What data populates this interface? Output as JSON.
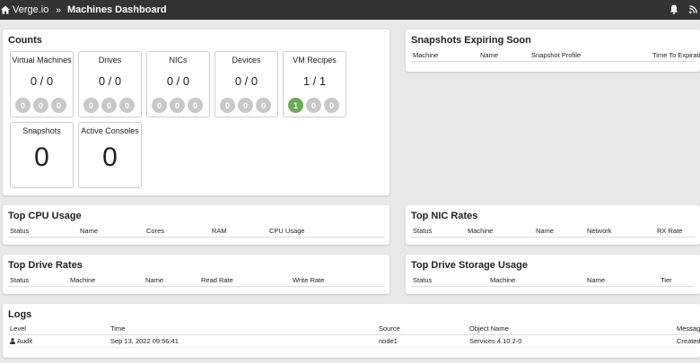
{
  "header": {
    "brand": "Verge.io",
    "separator": "»",
    "title": "Machines Dashboard"
  },
  "counts": {
    "title": "Counts",
    "tiles": [
      {
        "label": "Virtual Machines",
        "value": "0 / 0",
        "badges": [
          "0",
          "0",
          "0"
        ]
      },
      {
        "label": "Drives",
        "value": "0 / 0",
        "badges": [
          "0",
          "0",
          "0"
        ]
      },
      {
        "label": "NICs",
        "value": "0 / 0",
        "badges": [
          "0",
          "0",
          "0"
        ]
      },
      {
        "label": "Devices",
        "value": "0 / 0",
        "badges": [
          "0",
          "0",
          "0"
        ]
      },
      {
        "label": "VM Recipes",
        "value": "1 / 1",
        "badges": [
          "1",
          "0",
          "0"
        ]
      }
    ],
    "big_tiles": [
      {
        "label": "Snapshots",
        "value": "0"
      },
      {
        "label": "Active Consoles",
        "value": "0"
      }
    ]
  },
  "snapshots": {
    "title": "Snapshots Expiring Soon",
    "columns": [
      "Machine",
      "Name",
      "Snapshot Profile",
      "Time To Expiration"
    ]
  },
  "cpu": {
    "title": "Top CPU Usage",
    "columns": [
      "Status",
      "Name",
      "Cores",
      "RAM",
      "CPU Usage"
    ]
  },
  "nic": {
    "title": "Top NIC Rates",
    "columns": [
      "Status",
      "Machine",
      "Name",
      "Network",
      "RX Rate"
    ]
  },
  "drive_rates": {
    "title": "Top Drive Rates",
    "columns": [
      "Status",
      "Machine",
      "Name",
      "Read Rate",
      "Write Rate"
    ]
  },
  "drive_storage": {
    "title": "Top Drive Storage Usage",
    "columns": [
      "Status",
      "Machine",
      "Name",
      "Tier"
    ]
  },
  "logs": {
    "title": "Logs",
    "columns": [
      "Level",
      "Time",
      "Source",
      "Object Name",
      "Message"
    ],
    "rows": [
      {
        "level": "Audit",
        "time": "Sep 13, 2022 09:56:41",
        "source": "node1",
        "object": "Services 4.10.2-0",
        "message": "Created"
      }
    ]
  },
  "colors": {
    "topbar": "#333333",
    "badge_green": "#6ea85a",
    "badge_gray": "#c8c8c8"
  }
}
